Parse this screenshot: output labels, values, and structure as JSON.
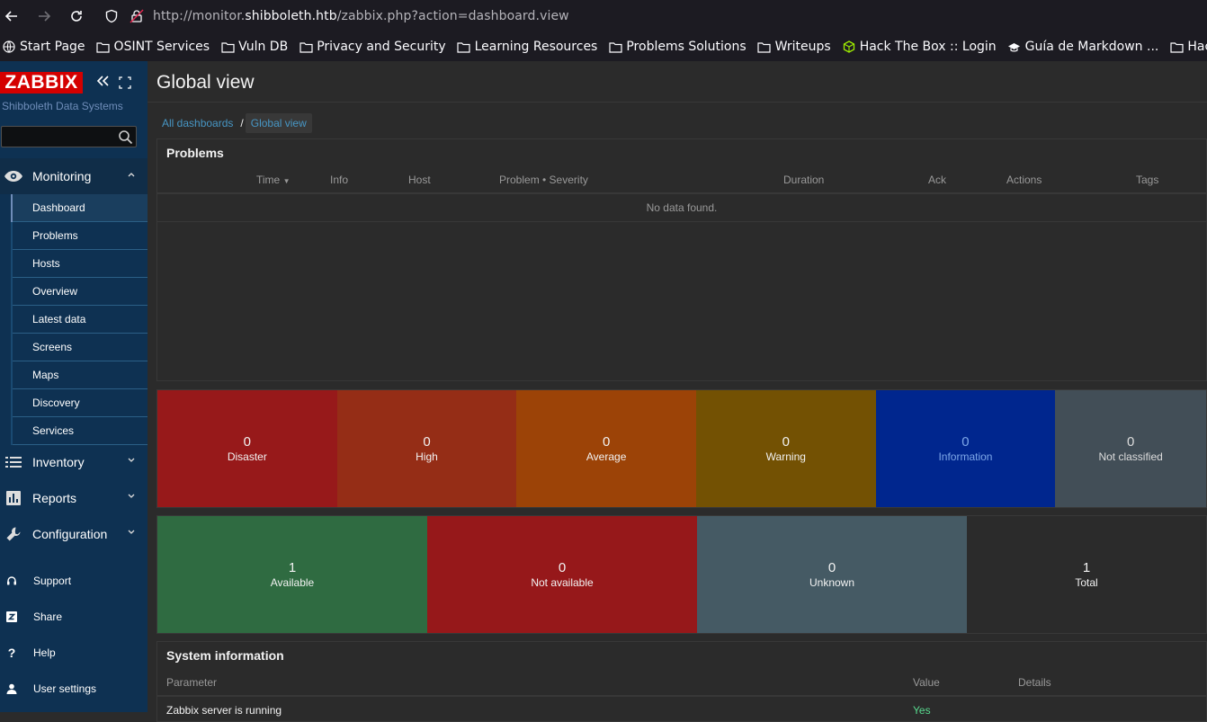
{
  "browser": {
    "url_prefix": "http://monitor.",
    "url_domain": "shibboleth.htb",
    "url_path": "/zabbix.php?action=dashboard.view",
    "bookmarks": [
      "Start Page",
      "OSINT Services",
      "Vuln DB",
      "Privacy and Security",
      "Learning Resources",
      "Problems Solutions",
      "Writeups",
      "Hack The Box :: Login",
      "Guía de Markdown ...",
      "HackingF"
    ]
  },
  "sidebar": {
    "logo": "ZABBIX",
    "company": "Shibboleth Data Systems",
    "search_placeholder": "",
    "monitoring_label": "Monitoring",
    "submenu": [
      "Dashboard",
      "Problems",
      "Hosts",
      "Overview",
      "Latest data",
      "Screens",
      "Maps",
      "Discovery",
      "Services"
    ],
    "inventory_label": "Inventory",
    "reports_label": "Reports",
    "configuration_label": "Configuration",
    "bottom": [
      "Support",
      "Share",
      "Help",
      "User settings"
    ]
  },
  "main": {
    "title": "Global view",
    "breadcrumb": [
      "All dashboards",
      "Global view"
    ],
    "problems": {
      "title": "Problems",
      "columns": [
        "Time",
        "Info",
        "Host",
        "Problem • Severity",
        "Duration",
        "Ack",
        "Actions",
        "Tags"
      ],
      "empty_text": "No data found."
    },
    "severities": [
      {
        "count": "0",
        "label": "Disaster",
        "color": "#97191a"
      },
      {
        "count": "0",
        "label": "High",
        "color": "#952d16"
      },
      {
        "count": "0",
        "label": "Average",
        "color": "#9c4307"
      },
      {
        "count": "0",
        "label": "Warning",
        "color": "#735103"
      },
      {
        "count": "0",
        "label": "Information",
        "color": "#00268e"
      },
      {
        "count": "0",
        "label": "Not classified",
        "color": "#424e57"
      }
    ],
    "hosts": [
      {
        "count": "1",
        "label": "Available",
        "color": "#2f6b41"
      },
      {
        "count": "0",
        "label": "Not available",
        "color": "#96181a"
      },
      {
        "count": "0",
        "label": "Unknown",
        "color": "#455a64"
      },
      {
        "count": "1",
        "label": "Total",
        "color": "#2b2b2b"
      }
    ],
    "sysinfo": {
      "title": "System information",
      "columns": [
        "Parameter",
        "Value",
        "Details"
      ],
      "row_param": "Zabbix server is running",
      "row_value": "Yes"
    }
  }
}
